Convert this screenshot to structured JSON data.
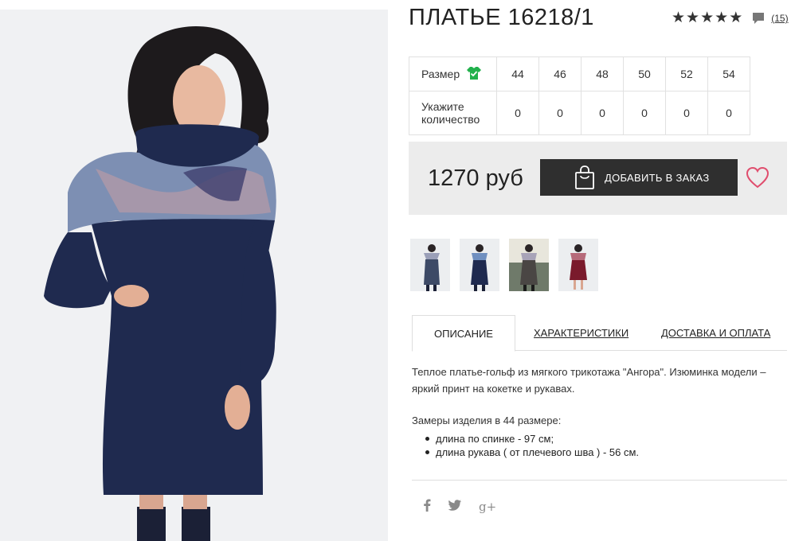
{
  "product": {
    "title": "ПЛАТЬЕ 16218/1",
    "rating_stars": 5,
    "reviews_count": "(15)"
  },
  "size_table": {
    "size_label": "Размер",
    "qty_label_line1": "Укажите",
    "qty_label_line2": "количество",
    "sizes": [
      "44",
      "46",
      "48",
      "50",
      "52",
      "54"
    ],
    "quantities": [
      "0",
      "0",
      "0",
      "0",
      "0",
      "0"
    ]
  },
  "order": {
    "price": "1270 руб",
    "add_button_label": "ДОБАВИТЬ В ЗАКАЗ"
  },
  "thumbnails": [
    "navy-print",
    "navy-print-front",
    "grey-print",
    "burgundy"
  ],
  "tabs": [
    {
      "label": "ОПИСАНИЕ",
      "active": true
    },
    {
      "label": "ХАРАКТЕРИСТИКИ",
      "active": false
    },
    {
      "label": "ДОСТАВКА И ОПЛАТА",
      "active": false
    }
  ],
  "description": {
    "text": "Теплое платье-гольф из мягкого трикотажа \"Ангора\". Изюминка модели – яркий принт на кокетке и рукавах.",
    "measurements_title": "Замеры изделия в 44 размере:",
    "measurements": [
      "длина по спинке - 97 см;",
      "длина рукава ( от плечевого шва ) - 56 см."
    ]
  },
  "social": {
    "facebook": "f",
    "twitter": "twitter-bird",
    "google": "g+"
  },
  "colors": {
    "accent_green": "#22b14c",
    "heart_pink": "#e04e6e",
    "button_dark": "#2f2f2f",
    "panel_bg": "#ececec",
    "dress_navy": "#1f2a4f"
  }
}
